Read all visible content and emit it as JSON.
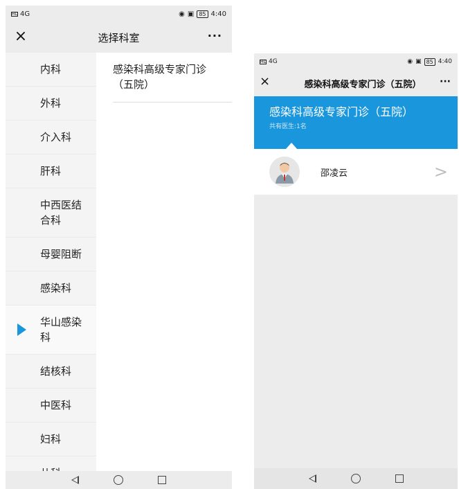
{
  "left": {
    "status": {
      "sim": "HD",
      "signal": "4G",
      "time": "4:40",
      "battery": "85"
    },
    "header": {
      "close_icon": "×",
      "title": "选择科室",
      "more_icon": "···"
    },
    "departments": [
      {
        "label": "内科"
      },
      {
        "label": "外科"
      },
      {
        "label": "介入科"
      },
      {
        "label": "肝科"
      },
      {
        "label": "中西医结合科"
      },
      {
        "label": "母婴阻断"
      },
      {
        "label": "感染科"
      },
      {
        "label": "华山感染科",
        "active": true
      },
      {
        "label": "结核科"
      },
      {
        "label": "中医科"
      },
      {
        "label": "妇科"
      },
      {
        "label": "儿科"
      }
    ],
    "sub_departments": [
      {
        "label": "感染科高级专家门诊（五院）"
      }
    ]
  },
  "right": {
    "status": {
      "sim": "HD",
      "signal": "4G",
      "time": "4:40",
      "battery": "85"
    },
    "header": {
      "close_icon": "×",
      "title": "感染科高级专家门诊（五院）",
      "more_icon": "···"
    },
    "banner": {
      "name": "感染科高级专家门诊（五院）",
      "count": "共有医生:1名",
      "color": "#1a96dc"
    },
    "doctors": [
      {
        "name": "邵凌云"
      }
    ]
  },
  "icons": {
    "close": "close-icon",
    "more": "more-icon",
    "active": "active-triangle-icon",
    "avatar": "doctor-avatar-icon",
    "chevron": "chevron-right-icon",
    "back": "back-triangle-icon",
    "home": "home-circle-icon",
    "recent": "recent-square-icon"
  },
  "colors": {
    "accent": "#1a96dc"
  }
}
